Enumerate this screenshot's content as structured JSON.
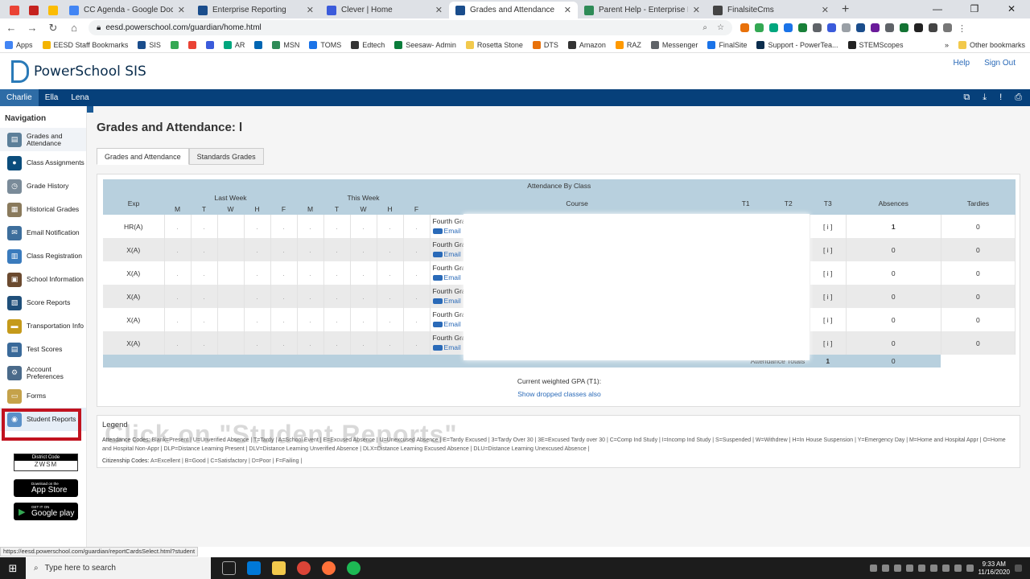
{
  "browser": {
    "tabs": [
      {
        "title": "CC Agenda - Google Docs",
        "color": "#4285f4",
        "active": false
      },
      {
        "title": "Enterprise Reporting",
        "color": "#1a4d8c",
        "active": false
      },
      {
        "title": "Clever | Home",
        "color": "#3b5bdb",
        "active": false
      },
      {
        "title": "Grades and Attendance",
        "color": "#1a4d8c",
        "active": true
      },
      {
        "title": "Parent Help - Enterprise Elementa",
        "color": "#2e8b57",
        "active": false
      },
      {
        "title": "FinalsiteCms",
        "color": "#444444",
        "active": false
      }
    ],
    "url": "eesd.powerschool.com/guardian/home.html",
    "bookmarks": [
      "Apps",
      "EESD Staff Bookmarks",
      "SIS",
      "",
      "",
      "",
      "AR",
      "",
      "MSN",
      "TOMS",
      "Edtech",
      "Seesaw- Admin",
      "Rosetta Stone",
      "DTS",
      "Amazon",
      "RAZ",
      "Messenger",
      "FinalSite",
      "Support - PowerTea...",
      "STEMScopes"
    ],
    "other_bookmarks": "Other bookmarks"
  },
  "ps": {
    "brand": "PowerSchool SIS",
    "help": "Help",
    "signout": "Sign Out",
    "students": [
      "Charlie",
      "Ella",
      "Lena"
    ],
    "nav_title": "Navigation",
    "nav_items": [
      {
        "label": "Grades and Attendance",
        "color": "#5c7f99"
      },
      {
        "label": "Class Assignments",
        "color": "#0b4d7c"
      },
      {
        "label": "Grade History",
        "color": "#7a8b99"
      },
      {
        "label": "Historical Grades",
        "color": "#8a7a5c"
      },
      {
        "label": "Email Notification",
        "color": "#3d6e9c"
      },
      {
        "label": "Class Registration",
        "color": "#3a7bbd"
      },
      {
        "label": "School Information",
        "color": "#6b4a2f"
      },
      {
        "label": "Score Reports",
        "color": "#1f4f7a"
      },
      {
        "label": "Transportation Info",
        "color": "#c59a1a"
      },
      {
        "label": "Test Scores",
        "color": "#3a6a9a"
      },
      {
        "label": "Account Preferences",
        "color": "#4a6a8a"
      },
      {
        "label": "Forms",
        "color": "#c5a24a"
      },
      {
        "label": "Student Reports",
        "color": "#5a90c8"
      }
    ],
    "district_label": "District Code",
    "district_code": "ZWSM",
    "appstore_small": "Download on the",
    "appstore_big": "App Store",
    "gplay_small": "GET IT ON",
    "gplay_big": "Google play"
  },
  "main": {
    "title": "Grades and Attendance: l",
    "tabs": [
      "Grades and Attendance",
      "Standards Grades"
    ],
    "table_title": "Attendance By Class",
    "headers": {
      "exp": "Exp",
      "last_week": "Last Week",
      "this_week": "This Week",
      "course": "Course",
      "t1": "T1",
      "t2": "T2",
      "t3": "T3",
      "absences": "Absences",
      "tardies": "Tardies"
    },
    "days": [
      "M",
      "T",
      "W",
      "H",
      "F",
      "M",
      "T",
      "W",
      "H",
      "F"
    ],
    "rows": [
      {
        "exp": "HR(A)",
        "course": "Fourth Gra",
        "email": "Email",
        "t3": "[ i ]",
        "absences": "1",
        "tardies": "0"
      },
      {
        "exp": "X(A)",
        "course": "Fourth Gra",
        "email": "Email",
        "t3": "[ i ]",
        "absences": "0",
        "tardies": "0"
      },
      {
        "exp": "X(A)",
        "course": "Fourth Gra",
        "email": "Email",
        "t3": "[ i ]",
        "absences": "0",
        "tardies": "0"
      },
      {
        "exp": "X(A)",
        "course": "Fourth Gra",
        "email": "Email",
        "t3": "[ i ]",
        "absences": "0",
        "tardies": "0"
      },
      {
        "exp": "X(A)",
        "course": "Fourth Gra",
        "email": "Email",
        "t3": "[ i ]",
        "absences": "0",
        "tardies": "0"
      },
      {
        "exp": "X(A)",
        "course": "Fourth Gra",
        "email": "Email",
        "t3": "[ i ]",
        "absences": "0",
        "tardies": "0"
      }
    ],
    "totals_label": "Attendance Totals",
    "totals_absences": "1",
    "totals_tardies": "0",
    "gpa": "Current weighted GPA (T1):",
    "dropped": "Show dropped classes also",
    "legend_title": "Legend",
    "attendance_codes_label": "Attendance Codes:",
    "attendance_codes": "Blank=Present | U=Unverified Absence | T=Tardy | A=School Event | E=Excused Absence | U=Unexcused Absence | E=Tardy Excused | 3=Tardy Over 30 | 3E=Excused Tardy over 30 | C=Comp Ind Study | I=Incomp Ind Study | S=Suspended | W=Withdrew | H=In House Suspension | Y=Emergency Day | M=Home and Hospital Appr | O=Home and Hospital Non-Appr | DLP=Distance Learning Present | DLV=Distance Learning Unverified Absence | DLX=Distance Learning Excused Absence | DLU=Distance Learning Unexcused Absence |",
    "citizenship_label": "Citizenship Codes:",
    "citizenship_codes": "A=Excellent | B=Good | C=Satisfactory | D=Poor | F=Failing |",
    "caption": "Click on \"Student Reports\""
  },
  "status_url": "https://eesd.powerschool.com/guardian/reportCardsSelect.html?student",
  "taskbar": {
    "search_placeholder": "Type here to search",
    "time": "9:33 AM",
    "date": "11/16/2020"
  }
}
